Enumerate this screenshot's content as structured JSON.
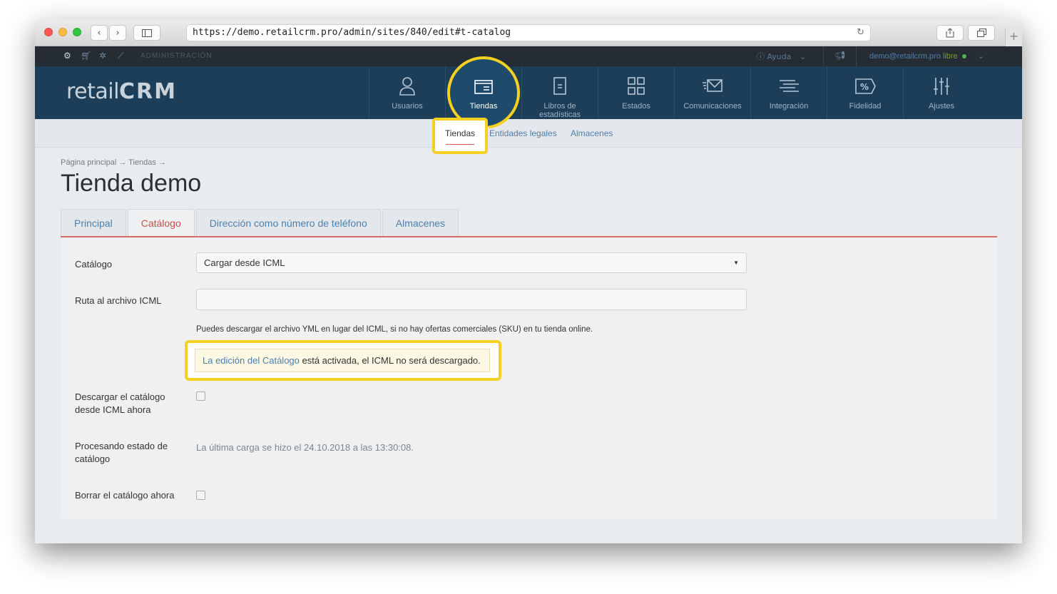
{
  "browser": {
    "url": "https://demo.retailcrm.pro/admin/sites/840/edit#t-catalog"
  },
  "adminbar": {
    "admin_label": "ADMINISTRACIÓN",
    "help_label": "Ayuda",
    "user_email": "demo@retailcrm.pro",
    "plan": "libre"
  },
  "header": {
    "logo_text": "retail",
    "logo_suffix": "CRM",
    "nav": [
      {
        "label": "Usuarios",
        "icon": "user-icon"
      },
      {
        "label": "Tiendas",
        "icon": "store-window-icon"
      },
      {
        "label": "Libros de estadísticas",
        "icon": "document-icon"
      },
      {
        "label": "Estados",
        "icon": "grid-icon"
      },
      {
        "label": "Comunicaciones",
        "icon": "mail-icon"
      },
      {
        "label": "Integración",
        "icon": "lines-icon"
      },
      {
        "label": "Fidelidad",
        "icon": "percent-tag-icon"
      },
      {
        "label": "Ajustes",
        "icon": "sliders-icon"
      }
    ],
    "active_nav": "Tiendas"
  },
  "subnav": {
    "items": [
      "Tiendas",
      "Entidades legales",
      "Almacenes"
    ]
  },
  "page": {
    "breadcrumb": "Página principal → Tiendas →",
    "title": "Tienda demo",
    "tabs": [
      "Principal",
      "Catálogo",
      "Dirección como número de teléfono",
      "Almacenes"
    ],
    "active_tab": "Catálogo"
  },
  "form": {
    "catalog_label": "Catálogo",
    "catalog_value": "Cargar desde ICML",
    "icml_path_label": "Ruta al archivo ICML",
    "icml_path_value": "",
    "hint": "Puedes descargar el archivo YML en lugar del ICML, si no hay ofertas comerciales (SKU) en tu tienda online.",
    "notice_link": "La edición del Catálogo",
    "notice_text": " está activada, el ICML no será descargado.",
    "download_label_line1": "Descargar el catálogo",
    "download_label_line2": "desde ICML ahora",
    "processing_label_line1": "Procesando estado de",
    "processing_label_line2": "catálogo",
    "processing_value": "La última carga se hizo el 24.10.2018 a las 13:30:08.",
    "delete_label": "Borrar el catálogo ahora"
  },
  "colors": {
    "header_bg": "#1c3e58",
    "highlight": "#f4d020",
    "active_tab": "#c9514c",
    "link": "#4b7fae"
  }
}
